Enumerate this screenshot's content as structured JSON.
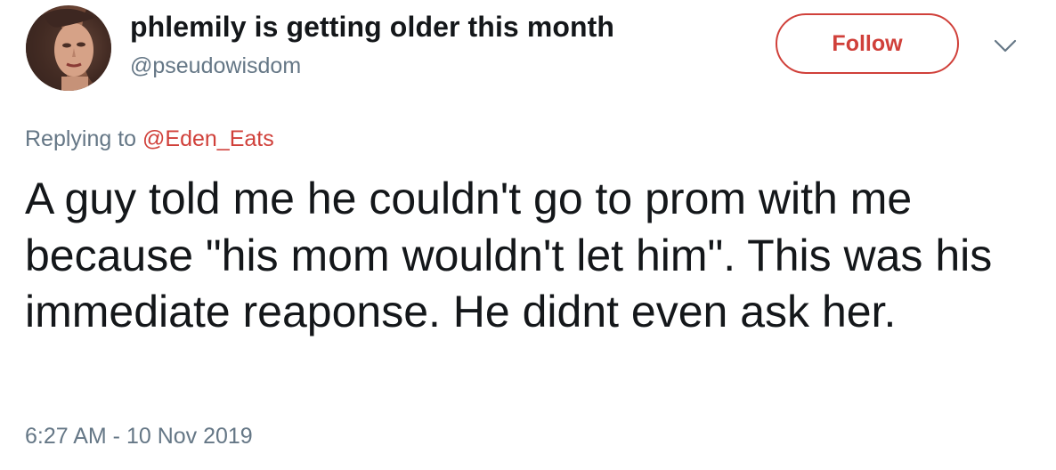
{
  "author": {
    "display_name": "phlemily is getting older this month",
    "handle": "@pseudowisdom",
    "avatar_icon": "profile-photo"
  },
  "actions": {
    "follow_label": "Follow",
    "menu_icon": "chevron-down-icon"
  },
  "reply": {
    "prefix": "Replying to ",
    "target": "@Eden_Eats"
  },
  "tweet": {
    "text": "A guy told me he couldn't go to prom with me because \"his mom wouldn't let him\". This was his immediate reaponse. He didnt even ask her.",
    "timestamp": "6:27 AM - 10 Nov 2019"
  },
  "colors": {
    "accent": "#d0403a",
    "secondary_text": "#657786",
    "primary_text": "#14171a"
  }
}
